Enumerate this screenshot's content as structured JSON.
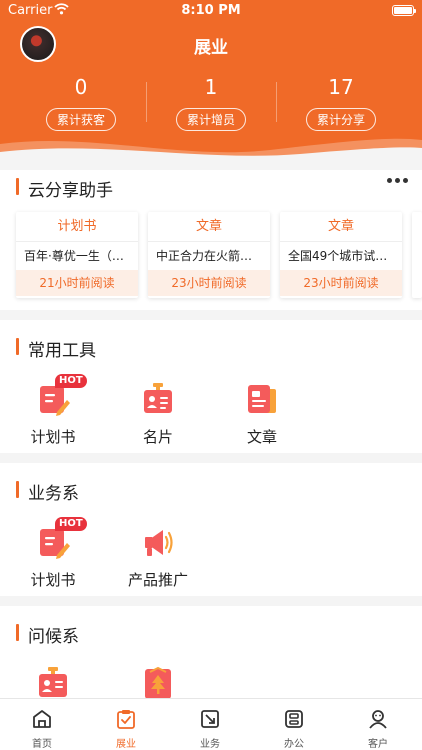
{
  "status_bar": {
    "carrier": "Carrier",
    "time": "8:10 PM"
  },
  "header": {
    "title": "展业"
  },
  "stats": [
    {
      "value": "0",
      "label": "累计获客"
    },
    {
      "value": "1",
      "label": "累计增员"
    },
    {
      "value": "17",
      "label": "累计分享"
    }
  ],
  "share_assistant": {
    "title": "云分享助手",
    "more_icon": "more-dots-icon",
    "cards": [
      {
        "tag": "计划书",
        "title": "百年·尊优一生（…",
        "time": "21小时前阅读"
      },
      {
        "tag": "文章",
        "title": "中正合力在火箭…",
        "time": "23小时前阅读"
      },
      {
        "tag": "文章",
        "title": "全国49个城市试…",
        "time": "23小时前阅读"
      }
    ]
  },
  "common_tools": {
    "title": "常用工具",
    "items": [
      {
        "label": "计划书",
        "icon": "plan-book-icon",
        "badge": "HOT"
      },
      {
        "label": "名片",
        "icon": "business-card-icon",
        "badge": ""
      },
      {
        "label": "文章",
        "icon": "article-icon",
        "badge": ""
      }
    ]
  },
  "business": {
    "title": "业务系",
    "items": [
      {
        "label": "计划书",
        "icon": "plan-book-icon",
        "badge": "HOT"
      },
      {
        "label": "产品推广",
        "icon": "megaphone-icon",
        "badge": ""
      }
    ]
  },
  "greeting": {
    "title": "问候系",
    "items": [
      {
        "label": "",
        "icon": "business-card-icon"
      },
      {
        "label": "",
        "icon": "festival-card-icon"
      }
    ]
  },
  "tabbar": {
    "active_color": "#f06a28",
    "items": [
      {
        "label": "首页",
        "icon": "home-icon"
      },
      {
        "label": "展业",
        "icon": "clipboard-check-icon"
      },
      {
        "label": "业务",
        "icon": "business-icon"
      },
      {
        "label": "办公",
        "icon": "office-icon"
      },
      {
        "label": "客户",
        "icon": "customer-icon"
      }
    ]
  },
  "colors": {
    "brand": "#f06a28",
    "hot": "#e8323c",
    "icon_red": "#f45b5b",
    "icon_orange": "#f8a23a"
  }
}
